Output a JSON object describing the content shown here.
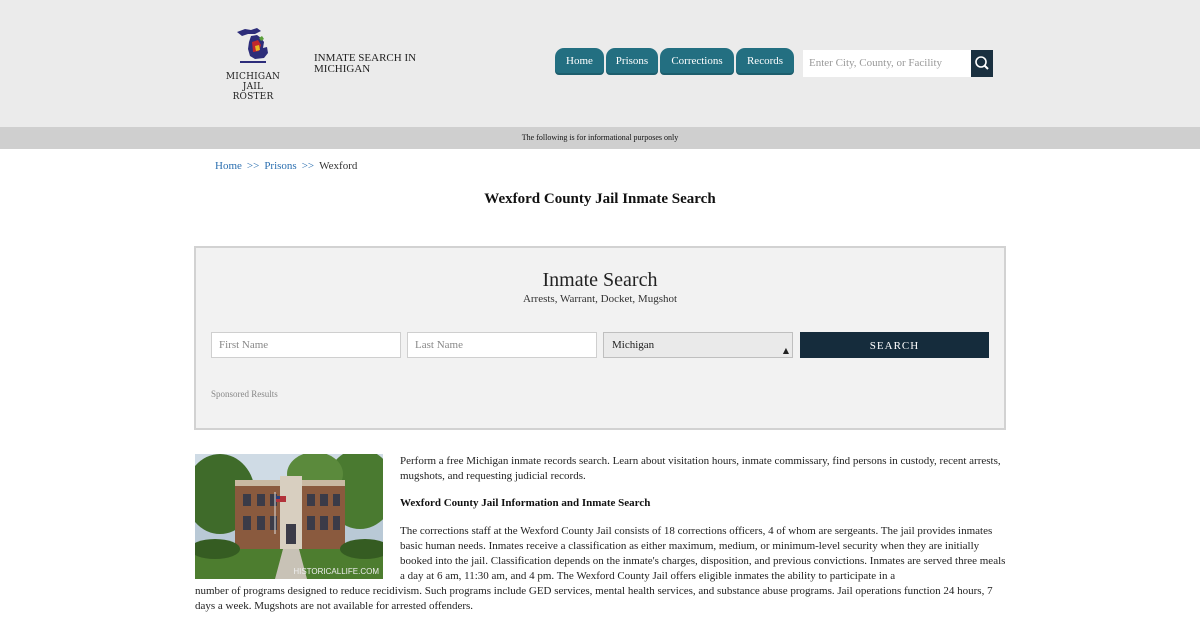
{
  "brand": {
    "logo_line1": "MICHIGAN",
    "logo_line2": "JAIL ROSTER",
    "site_title": "INMATE SEARCH IN MICHIGAN"
  },
  "nav": {
    "items": [
      "Home",
      "Prisons",
      "Corrections",
      "Records"
    ],
    "search_placeholder": "Enter City, County, or Facility"
  },
  "banner": "The following is for informational purposes only",
  "breadcrumb": {
    "home": "Home",
    "sep": ">>",
    "prisons": "Prisons",
    "current": "Wexford"
  },
  "page_title": "Wexford County Jail Inmate Search",
  "search_panel": {
    "title": "Inmate Search",
    "subtitle": "Arrests, Warrant, Docket, Mugshot",
    "first_name_placeholder": "First Name",
    "last_name_placeholder": "Last Name",
    "state_selected": "Michigan",
    "button_label": "SEARCH",
    "sponsored": "Sponsored Results"
  },
  "content": {
    "photo_caption": "HISTORICALLIFE.COM",
    "intro": "Perform a free Michigan inmate records search. Learn about visitation hours, inmate commissary, find persons in custody, recent arrests, mugshots, and requesting judicial records.",
    "heading": "Wexford County Jail Information and Inmate Search",
    "body": "The corrections staff at the Wexford County Jail consists of 18 corrections officers, 4 of whom are sergeants. The jail provides inmates basic human needs. Inmates receive a classification as either maximum, medium, or minimum-level security when they are initially booked into the jail. Classification depends on the inmate's charges, disposition, and previous convictions. Inmates are served three meals a day at 6 am, 11:30 am, and 4 pm. The Wexford County Jail offers eligible inmates the ability to participate in a number of programs designed to reduce recidivism. Such programs include GED services, mental health services, and substance abuse programs. Jail operations function 24 hours, 7 days a week. Mugshots are not available for arrested offenders."
  },
  "colors": {
    "nav_bg": "#236f81",
    "header_bg": "#ebebeb",
    "search_button_bg": "#152c3c",
    "link": "#2b6fb0"
  }
}
